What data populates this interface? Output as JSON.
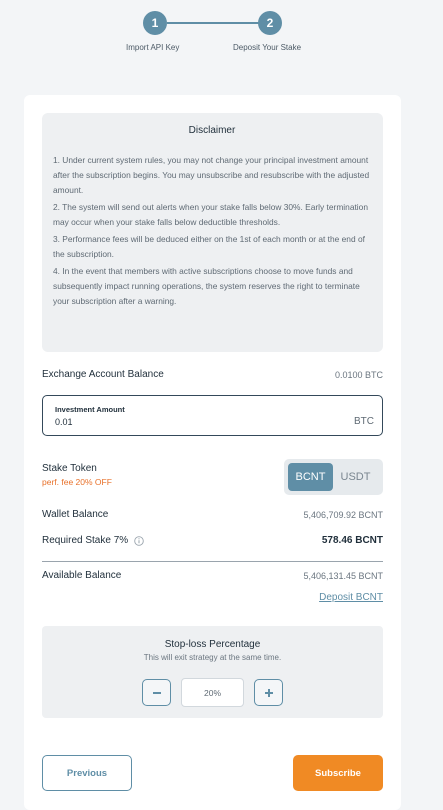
{
  "stepper": {
    "steps": [
      {
        "number": "1",
        "label": "Import API Key"
      },
      {
        "number": "2",
        "label": "Deposit Your Stake"
      }
    ]
  },
  "disclaimer": {
    "title": "Disclaimer",
    "items": [
      "1. Under current system rules, you may not change your principal investment amount after the subscription begins. You may unsubscribe and resubscribe with the adjusted amount.",
      "2. The system will send out alerts when your stake falls below 30%. Early termination may occur when your stake falls below deductible thresholds.",
      "3. Performance fees will be deduced either on the 1st of each month or at the end of the subscription.",
      "4. In the event that members with active subscriptions choose to move funds and subsequently impact running operations, the system reserves the right to terminate your subscription after a warning."
    ]
  },
  "exchange": {
    "label": "Exchange Account Balance",
    "value": "0.0100 BTC"
  },
  "investment": {
    "label": "Investment Amount",
    "value": "0.01",
    "unit": "BTC"
  },
  "stake_token": {
    "label": "Stake Token",
    "fee_note": "perf. fee 20% OFF",
    "options": [
      "BCNT",
      "USDT"
    ],
    "selected": "BCNT"
  },
  "wallet": {
    "label": "Wallet Balance",
    "value": "5,406,709.92 BCNT"
  },
  "required": {
    "label": "Required Stake 7%",
    "value": "578.46 BCNT"
  },
  "available": {
    "label": "Available Balance",
    "value": "5,406,131.45 BCNT"
  },
  "deposit_link": "Deposit BCNT",
  "stop_loss": {
    "title": "Stop-loss Percentage",
    "subtitle": "This will exit strategy at the same time.",
    "value": "20%"
  },
  "buttons": {
    "previous": "Previous",
    "subscribe": "Subscribe"
  },
  "colors": {
    "accent": "#5f8ea6",
    "primary_action": "#f08a24",
    "fee_note": "#e8712a"
  },
  "icons": {
    "info": "info-icon",
    "minus": "minus-icon",
    "plus": "plus-icon"
  }
}
